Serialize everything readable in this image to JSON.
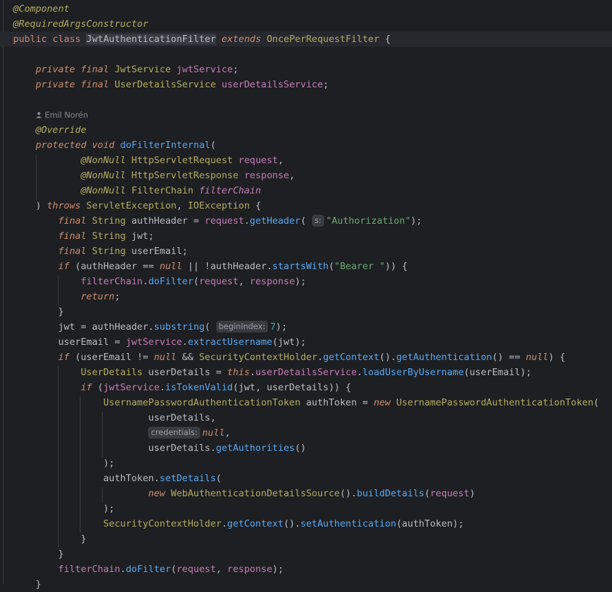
{
  "editor": {
    "author_hint": "Emil Norén",
    "lines": [
      "@Component",
      "@RequiredArgsConstructor",
      "public class JwtAuthenticationFilter extends OncePerRequestFilter {",
      "",
      "    private final JwtService jwtService;",
      "    private final UserDetailsService userDetailsService;",
      "",
      "    @Override",
      "    protected void doFilterInternal(",
      "            @NonNull HttpServletRequest request,",
      "            @NonNull HttpServletResponse response,",
      "            @NonNull FilterChain filterChain",
      "    ) throws ServletException, IOException {",
      "        final String authHeader = request.getHeader(\"Authorization\");",
      "        final String jwt;",
      "        final String userEmail;",
      "        if (authHeader == null || !authHeader.startsWith(\"Bearer \")) {",
      "            filterChain.doFilter(request, response);",
      "            return;",
      "        }",
      "        jwt = authHeader.substring(7);",
      "        userEmail = jwtService.extractUsername(jwt);",
      "        if (userEmail != null && SecurityContextHolder.getContext().getAuthentication() == null) {",
      "            UserDetails userDetails = this.userDetailsService.loadUserByUsername(userEmail);",
      "            if (jwtService.isTokenValid(jwt, userDetails)) {",
      "                UsernamePasswordAuthenticationToken authToken = new UsernamePasswordAuthenticationToken(",
      "                        userDetails,",
      "                        null,",
      "                        userDetails.getAuthorities()",
      "                );",
      "                authToken.setDetails(",
      "                        new WebAuthenticationDetailsSource().buildDetails(request)",
      "                );",
      "                SecurityContextHolder.getContext().setAuthentication(authToken);",
      "            }",
      "        }",
      "        filterChain.doFilter(request, response);",
      "    }"
    ],
    "param_hints": {
      "getHeader": "s:",
      "substring": "beginIndex:",
      "credentials": "credentials:"
    }
  },
  "colors": {
    "background": "#1e1f22",
    "keyword": "#cf8e6d",
    "annotation": "#b3ae60",
    "field": "#c77dbb",
    "method": "#56a8f5",
    "string": "#6aab73",
    "number": "#2aacb8"
  },
  "icons": [
    "person-icon"
  ]
}
